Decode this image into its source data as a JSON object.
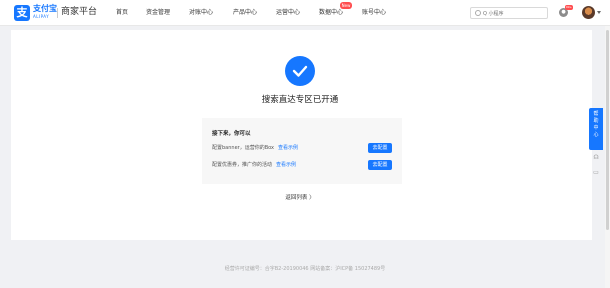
{
  "brand": {
    "logo_glyph": "支",
    "name": "支付宝",
    "sub": "ALIPAY",
    "platform": "商家平台"
  },
  "nav": [
    {
      "label": "首页"
    },
    {
      "label": "资金管理"
    },
    {
      "label": "对账中心"
    },
    {
      "label": "产品中心"
    },
    {
      "label": "运营中心"
    },
    {
      "label": "数据中心",
      "badge": "New"
    },
    {
      "label": "账号中心"
    }
  ],
  "search": {
    "placeholder": "Q 小程序"
  },
  "notifications": {
    "icon": "bell-icon",
    "count": "99+"
  },
  "success": {
    "title": "搜索直达专区已开通"
  },
  "next_steps": {
    "title": "接下来，你可以",
    "items": [
      {
        "text": "配置banner，运营你的Box",
        "link": "查看示例",
        "button": "去配置"
      },
      {
        "text": "配置优惠券，推广你的活动",
        "link": "查看示例",
        "button": "去配置"
      }
    ]
  },
  "back": {
    "label": "返回列表 〉"
  },
  "footer": {
    "text": "经营许可证编号：合字B2-20190046 网站备案：沪ICP备 15027489号"
  },
  "help": {
    "chars": [
      "帮",
      "助",
      "中",
      "心"
    ]
  },
  "side_icons": [
    {
      "glyph": "☊"
    },
    {
      "glyph": "▭"
    }
  ],
  "colors": {
    "accent": "#1677ff",
    "badge": "#ff4d4f",
    "background": "#f0f1f4"
  }
}
